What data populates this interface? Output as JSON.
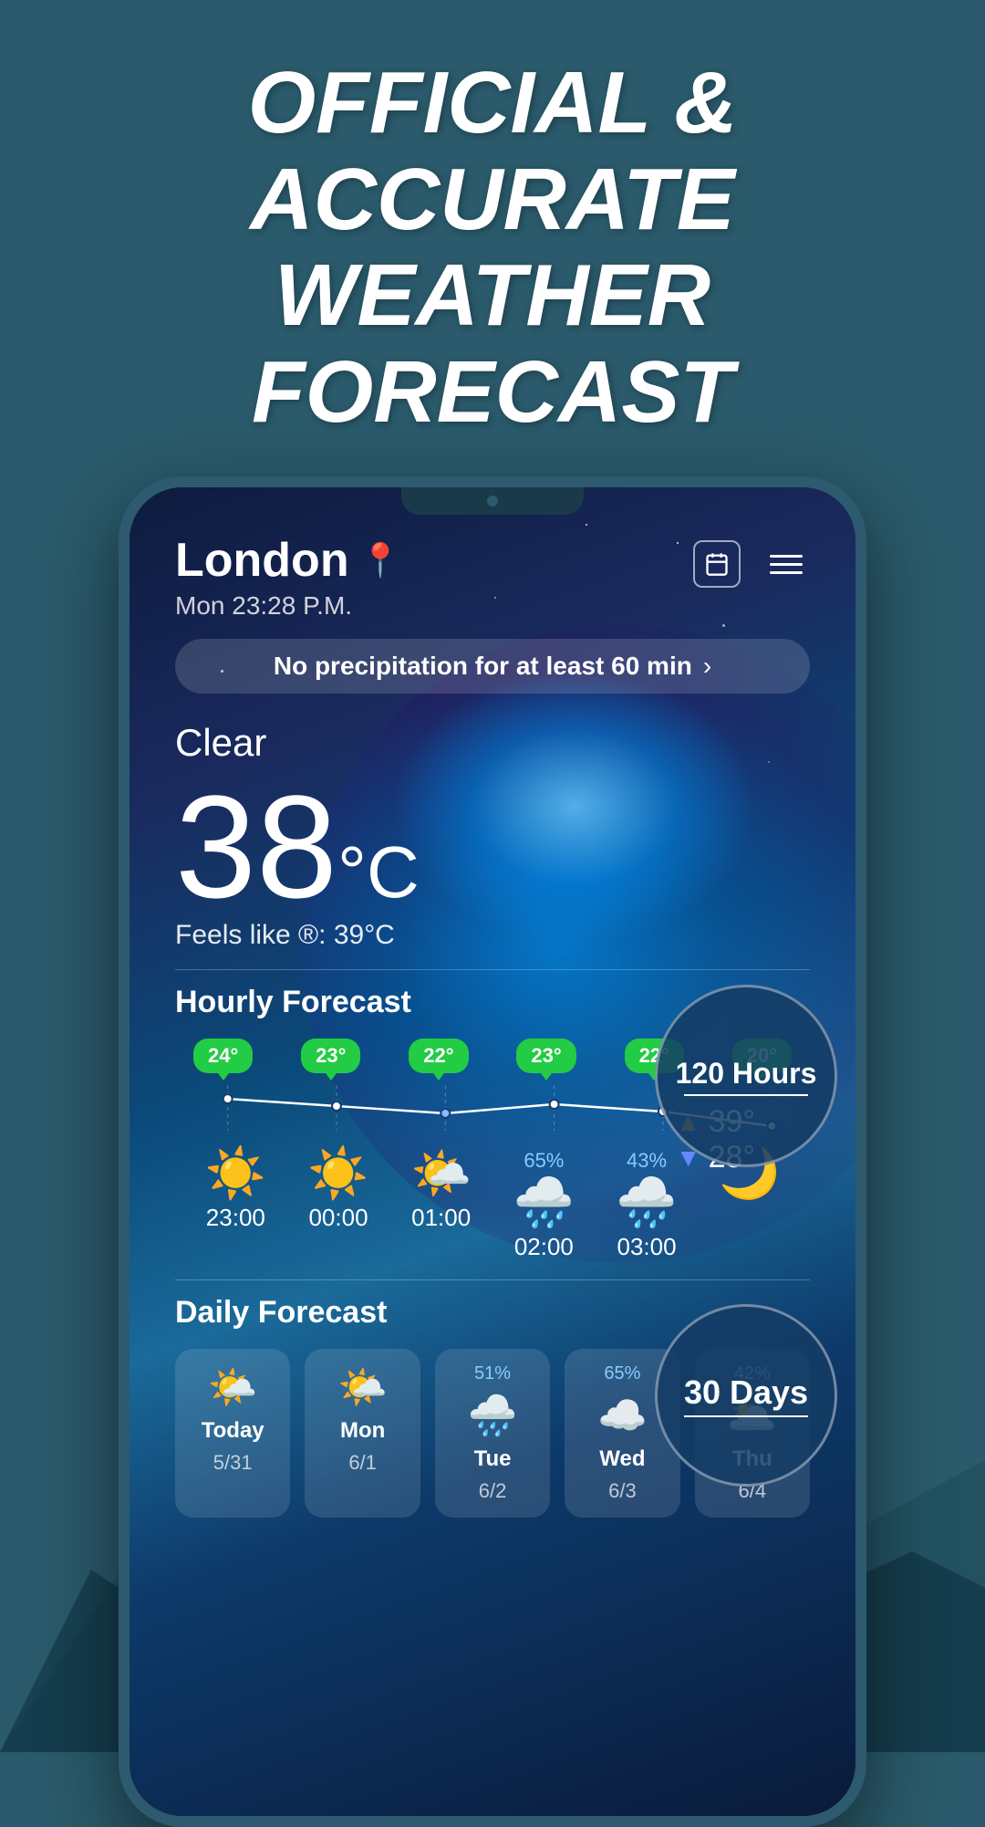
{
  "page": {
    "header": {
      "line1": "OFFICIAL & ACCURATE",
      "line2": "WEATHER FORECAST"
    }
  },
  "app": {
    "location": "London",
    "time": "Mon   23:28 P.M.",
    "precipitation_alert": "No precipitation for at least 60 min",
    "condition": "Clear",
    "temperature": "38°C",
    "temp_high": "39°",
    "temp_low": "28°",
    "feels_like": "Feels like ®: 39°C",
    "hourly_label": "Hourly Forecast",
    "daily_label": "Daily Forecast",
    "hours_badge": "120 Hours",
    "days_badge": "30 Days",
    "hourly": [
      {
        "temp": "24°",
        "icon": "☀️",
        "time": "23:00",
        "rain": ""
      },
      {
        "temp": "23°",
        "icon": "☀️",
        "time": "00:00",
        "rain": ""
      },
      {
        "temp": "22°",
        "icon": "🌤️",
        "time": "01:00",
        "rain": ""
      },
      {
        "temp": "23°",
        "icon": "☁️",
        "time": "02:00",
        "rain": "65%"
      },
      {
        "temp": "22°",
        "icon": "🌧️",
        "time": "03:00",
        "rain": "43%"
      },
      {
        "temp": "20°",
        "icon": "🌙",
        "time": "",
        "rain": ""
      }
    ],
    "daily": [
      {
        "day": "Today",
        "date": "5/31",
        "icon": "🌤️",
        "rain": ""
      },
      {
        "day": "Mon",
        "date": "6/1",
        "icon": "🌤️",
        "rain": ""
      },
      {
        "day": "Tue",
        "date": "6/2",
        "icon": "🌧️",
        "rain": "51%"
      },
      {
        "day": "Wed",
        "date": "6/3",
        "icon": "☁️",
        "rain": "65%"
      },
      {
        "day": "Thu",
        "date": "6/4",
        "icon": "🌥️",
        "rain": "42%"
      }
    ]
  }
}
